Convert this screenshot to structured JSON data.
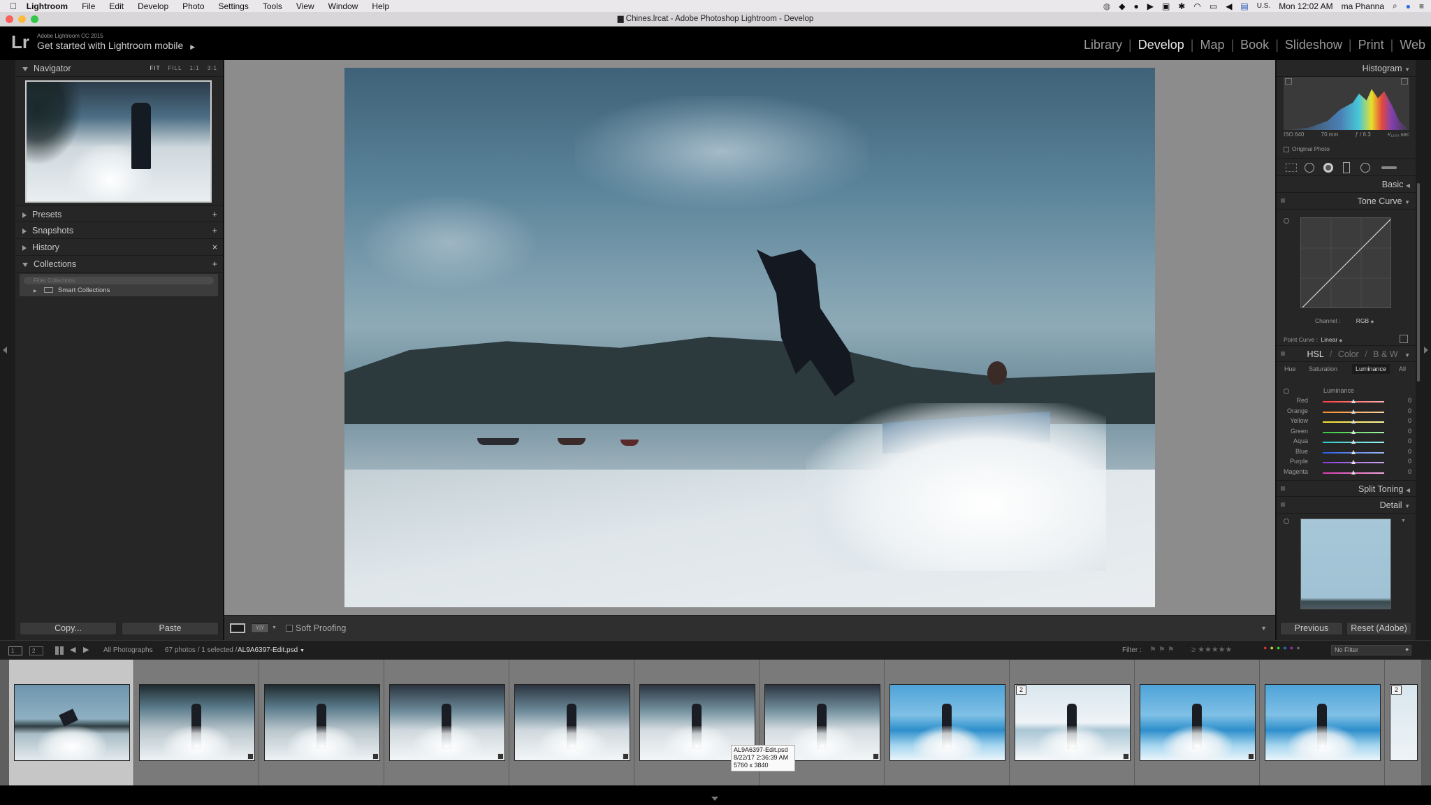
{
  "menubar": {
    "app": "Lightroom",
    "items": [
      "File",
      "Edit",
      "Develop",
      "Photo",
      "Settings",
      "Tools",
      "View",
      "Window",
      "Help"
    ],
    "locale": "U.S.",
    "clock": "Mon 12:02 AM",
    "user": "ma Phanna"
  },
  "titlebar": {
    "title": "Chines.lrcat - Adobe Photoshop Lightroom - Develop"
  },
  "identity": {
    "product": "Adobe Lightroom CC 2015",
    "tagline": "Get started with Lightroom mobile",
    "logo": "Lr"
  },
  "modules": [
    "Library",
    "Develop",
    "Map",
    "Book",
    "Slideshow",
    "Print",
    "Web"
  ],
  "left": {
    "navigator": "Navigator",
    "zoom": [
      "FIT",
      "FILL",
      "1:1",
      "3:1"
    ],
    "sections": [
      {
        "label": "Presets",
        "icon": "+"
      },
      {
        "label": "Snapshots",
        "icon": "+"
      },
      {
        "label": "History",
        "icon": "×"
      },
      {
        "label": "Collections",
        "icon": "+"
      }
    ],
    "filter_placeholder": "Filter Collections",
    "smart": "Smart Collections",
    "copy": "Copy...",
    "paste": "Paste"
  },
  "right": {
    "histogram": "Histogram",
    "exif": {
      "iso": "ISO 640",
      "focal": "70 mm",
      "aperture": "ƒ / 6.3",
      "shutter": "¹⁄₁₂₅₀ sec"
    },
    "original": "Original Photo",
    "basic": "Basic",
    "tone": "Tone Curve",
    "channel_label": "Channel :",
    "channel": "RGB",
    "pc_label": "Point Curve :",
    "pc": "Linear",
    "hsl": [
      "HSL",
      "Color",
      "B & W"
    ],
    "hsl_tabs": [
      "Hue",
      "Saturation",
      "Luminance",
      "All"
    ],
    "lum_title": "Luminance",
    "sliders": [
      {
        "name": "Red",
        "value": "0",
        "c1": "#ff3b3b",
        "c2": "#ffb0b0"
      },
      {
        "name": "Orange",
        "value": "0",
        "c1": "#ff8a2a",
        "c2": "#ffd0a0"
      },
      {
        "name": "Yellow",
        "value": "0",
        "c1": "#f4e02a",
        "c2": "#fff5a0"
      },
      {
        "name": "Green",
        "value": "0",
        "c1": "#34c93a",
        "c2": "#a8f0aa"
      },
      {
        "name": "Aqua",
        "value": "0",
        "c1": "#2ac8c8",
        "c2": "#a0f0f0"
      },
      {
        "name": "Blue",
        "value": "0",
        "c1": "#2a5ce8",
        "c2": "#a0b8f8"
      },
      {
        "name": "Purple",
        "value": "0",
        "c1": "#8a3ad8",
        "c2": "#d2a8f6"
      },
      {
        "name": "Magenta",
        "value": "0",
        "c1": "#d83ab0",
        "c2": "#f6a8e0"
      }
    ],
    "split": "Split Toning",
    "detail": "Detail",
    "previous": "Previous",
    "reset": "Reset (Adobe)"
  },
  "toolbar": {
    "soft": "Soft Proofing"
  },
  "filmbar": {
    "p1": "1",
    "p2": "2",
    "source": "All Photographs",
    "count": "67 photos / 1 selected /",
    "file": "AL9A6397-Edit.psd",
    "filter_label": "Filter :",
    "no_filter": "No Filter"
  },
  "tooltip": [
    "AL9A6397-Edit.psd",
    "8/22/17 2:36:39 AM",
    "5760 x 3840"
  ],
  "badges": [
    "2",
    "2"
  ]
}
